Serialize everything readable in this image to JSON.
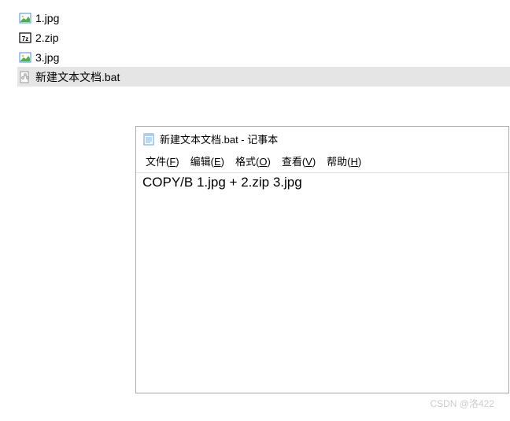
{
  "files": [
    {
      "name": "1.jpg",
      "icon": "image"
    },
    {
      "name": "2.zip",
      "icon": "7z"
    },
    {
      "name": "3.jpg",
      "icon": "image"
    },
    {
      "name": "新建文本文档.bat",
      "icon": "bat",
      "selected": true
    }
  ],
  "notepad": {
    "title": "新建文本文档.bat - 记事本",
    "menus": [
      {
        "label": "文件",
        "key": "F"
      },
      {
        "label": "编辑",
        "key": "E"
      },
      {
        "label": "格式",
        "key": "O"
      },
      {
        "label": "查看",
        "key": "V"
      },
      {
        "label": "帮助",
        "key": "H"
      }
    ],
    "content": "COPY/B 1.jpg + 2.zip 3.jpg"
  },
  "watermark": "CSDN @洛422"
}
